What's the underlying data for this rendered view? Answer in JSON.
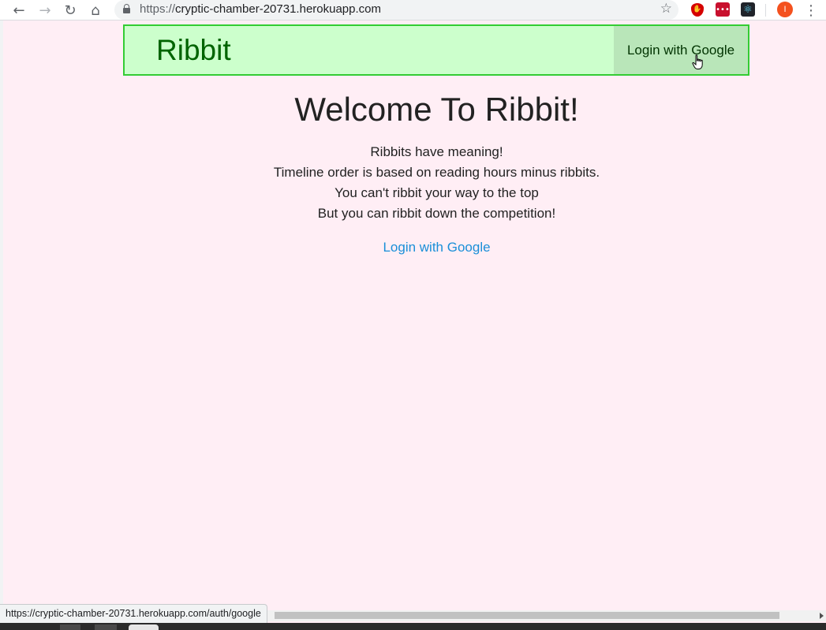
{
  "browser": {
    "url_scheme": "https://",
    "url_host": "cryptic-chamber-20731.herokuapp.com",
    "profile_initial": "I",
    "back_icon": "←",
    "forward_icon": "→",
    "reload_icon": "↻",
    "home_icon": "⌂",
    "star_icon": "☆",
    "menu_icon": "⋮",
    "ublock_icon": "✋",
    "lastpass_icon": "•••",
    "react_icon": "⚛"
  },
  "header": {
    "brand": "Ribbit",
    "login_label": "Login with Google"
  },
  "main": {
    "title": "Welcome To Ribbit!",
    "lines": [
      "Ribbits have meaning!",
      "Timeline order is based on reading hours minus ribbits.",
      "You can't ribbit your way to the top",
      "But you can ribbit down the competition!"
    ],
    "login_label": "Login with Google"
  },
  "status_bar": {
    "link_url": "https://cryptic-chamber-20731.herokuapp.com/auth/google"
  },
  "colors": {
    "page_bg": "#ffeef5",
    "header_bg": "#ccffcc",
    "header_border": "#33cc33",
    "header_login_bg": "#b9e6b9",
    "brand": "#006400",
    "link": "#1a8fd8"
  }
}
